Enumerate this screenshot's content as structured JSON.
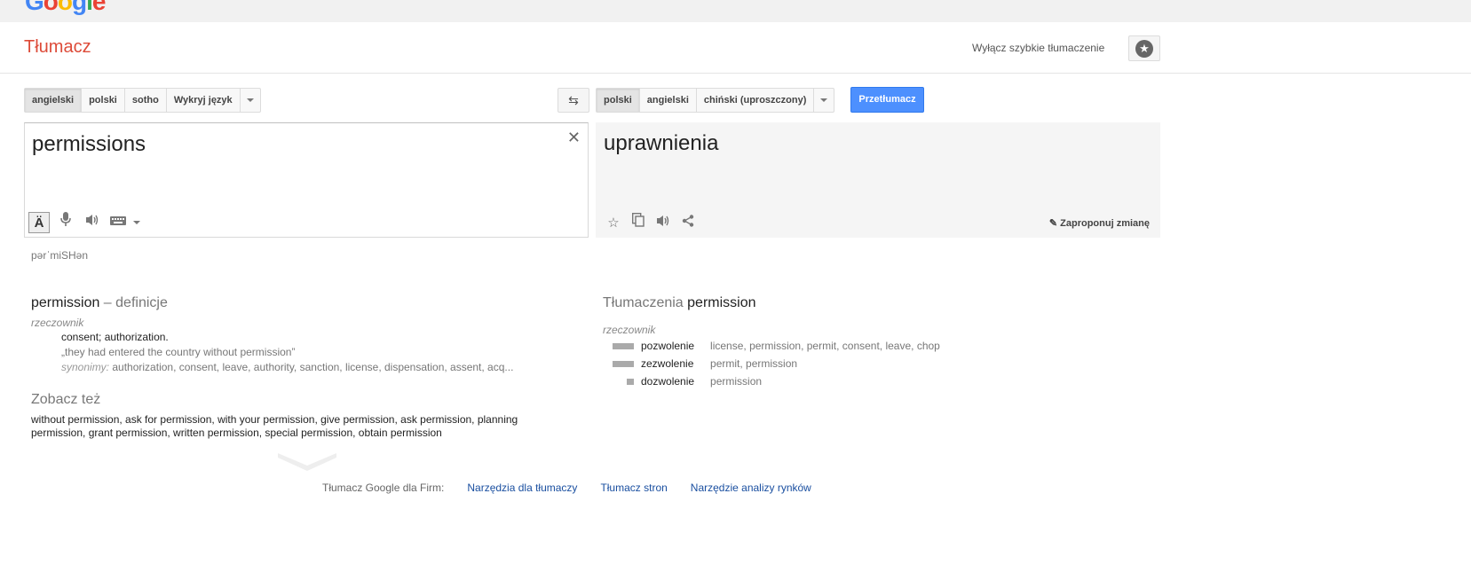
{
  "header": {
    "app_title": "Tłumacz",
    "instant_toggle": "Wyłącz szybkie tłumaczenie"
  },
  "source_langs": [
    "angielski",
    "polski",
    "sotho",
    "Wykryj język"
  ],
  "target_langs": [
    "polski",
    "angielski",
    "chiński (uproszczony)"
  ],
  "translate_button": "Przetłumacz",
  "source": {
    "text": "permissions",
    "phonetic": "pərˈmiSHən"
  },
  "target": {
    "text": "uprawnienia",
    "suggest_edit": "Zaproponuj zmianę"
  },
  "definitions": {
    "word": "permission",
    "suffix": " – definicje",
    "pos": "rzeczownik",
    "meaning": "consent; authorization.",
    "example": "„they had entered the country without permission”",
    "synonyms_label": "synonimy:",
    "synonyms": " authorization, consent, leave, authority, sanction, license, dispensation, assent, acq..."
  },
  "see_also": {
    "heading": "Zobacz też",
    "text": "without permission, ask for permission, with your permission, give permission, ask permission, planning permission, grant permission, written permission, special permission, obtain permission"
  },
  "translations": {
    "heading_prefix": "Tłumaczenia ",
    "word": "permission",
    "pos": "rzeczownik",
    "rows": [
      {
        "word": "pozwolenie",
        "freq": 1.0,
        "syns": "license, permission, permit, consent, leave, chop"
      },
      {
        "word": "zezwolenie",
        "freq": 1.0,
        "syns": "permit, permission"
      },
      {
        "word": "dozwolenie",
        "freq": 0.33,
        "syns": "permission"
      }
    ]
  },
  "footer": {
    "label": "Tłumacz Google dla Firm:",
    "links": [
      "Narzędzia dla tłumaczy",
      "Tłumacz stron",
      "Narzędzie analizy rynków"
    ]
  },
  "colors": {
    "brand_red": "#dd4b39",
    "button_blue": "#4d90fe",
    "link_blue": "#1a4fa0"
  }
}
